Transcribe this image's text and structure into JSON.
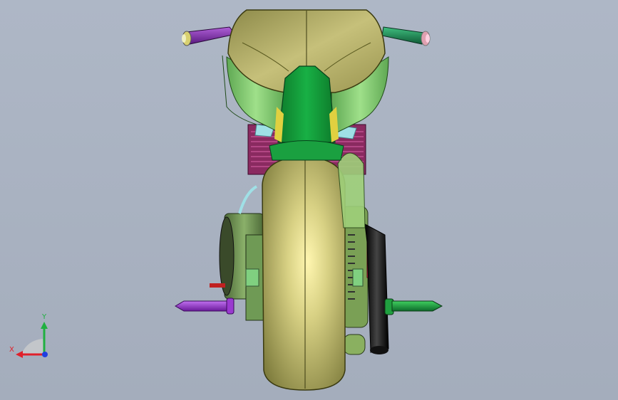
{
  "viewport": {
    "background_color": "#aab3c2",
    "model": {
      "subject": "motorcycle",
      "view": "rear",
      "colors": {
        "tire": "#c9c37a",
        "seat": "#b9b46a",
        "fender": "#78c86a",
        "tail_panel": "#129a3a",
        "left_grip": "#7a2aa0",
        "right_grip": "#1f8a55",
        "left_peg": "#8a2fc0",
        "right_peg": "#1a9a40",
        "exhaust": "#1a1a1a",
        "engine_fins": "#7a1a4a",
        "accent_cyan": "#9fe0e6",
        "accent_red": "#c02040"
      }
    },
    "triad": {
      "x_label": "X",
      "y_label": "Y",
      "colors": {
        "x": "#e0202a",
        "y": "#20b040",
        "z": "#2040e0"
      }
    }
  }
}
